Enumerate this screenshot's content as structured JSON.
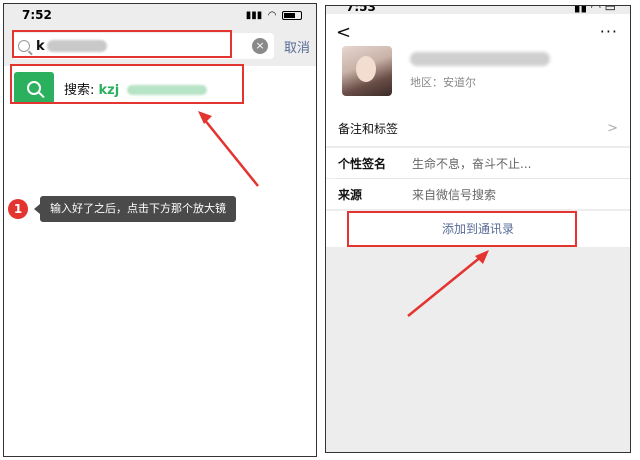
{
  "left_screen": {
    "time": "7:52",
    "search_query": "k",
    "cancel_label": "取消",
    "result_label": "搜索:",
    "result_value": "kzj",
    "tip_number": "1",
    "tip_text": "输入好了之后，点击下方那个放大镜"
  },
  "right_screen": {
    "time": "7:53",
    "back_label": "<",
    "more_label": "···",
    "region": "地区：安道尔",
    "remarks_label": "备注和标签",
    "signature_label": "个性签名",
    "signature_value": "生命不息，奋斗不止...",
    "source_label": "来源",
    "source_value": "来自微信号搜索",
    "add_contact_label": "添加到通讯录"
  },
  "colors": {
    "annotation_red": "#e3342f",
    "wechat_green": "#2bb15d",
    "link_blue": "#576b95"
  }
}
